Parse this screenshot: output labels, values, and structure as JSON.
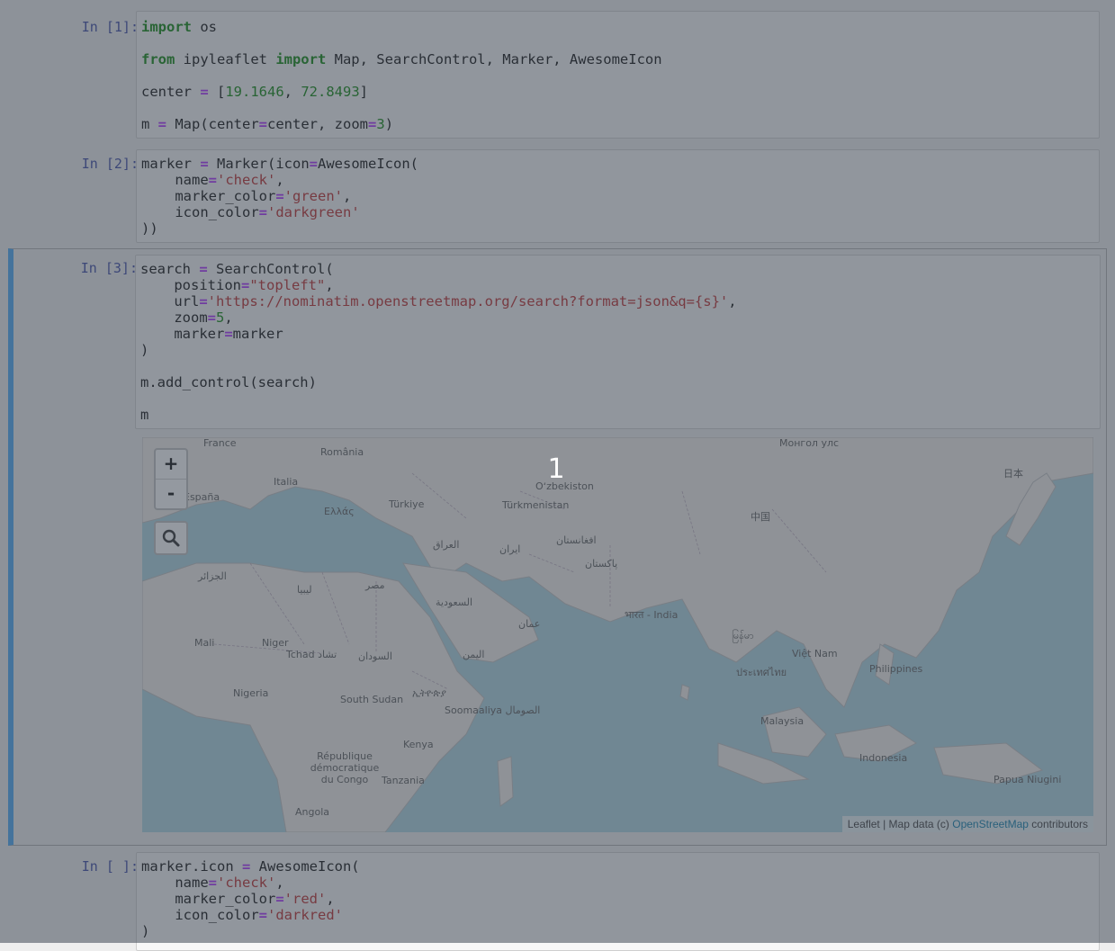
{
  "cells": [
    {
      "prompt": "In [1]:",
      "lines": [
        [
          {
            "t": "import",
            "c": "kw"
          },
          {
            "t": " os"
          }
        ],
        [],
        [
          {
            "t": "from",
            "c": "kw"
          },
          {
            "t": " ipyleaflet "
          },
          {
            "t": "import",
            "c": "kw"
          },
          {
            "t": " Map, SearchControl, Marker, AwesomeIcon"
          }
        ],
        [],
        [
          {
            "t": "center "
          },
          {
            "t": "=",
            "c": "op"
          },
          {
            "t": " ["
          },
          {
            "t": "19.1646",
            "c": "num"
          },
          {
            "t": ", "
          },
          {
            "t": "72.8493",
            "c": "num"
          },
          {
            "t": "]"
          }
        ],
        [],
        [
          {
            "t": "m "
          },
          {
            "t": "=",
            "c": "op"
          },
          {
            "t": " Map(center"
          },
          {
            "t": "=",
            "c": "op"
          },
          {
            "t": "center, zoom"
          },
          {
            "t": "=",
            "c": "op"
          },
          {
            "t": "3",
            "c": "num"
          },
          {
            "t": ")"
          }
        ]
      ]
    },
    {
      "prompt": "In [2]:",
      "lines": [
        [
          {
            "t": "marker "
          },
          {
            "t": "=",
            "c": "op"
          },
          {
            "t": " Marker(icon"
          },
          {
            "t": "=",
            "c": "op"
          },
          {
            "t": "AwesomeIcon("
          }
        ],
        [
          {
            "t": "    name"
          },
          {
            "t": "=",
            "c": "op"
          },
          {
            "t": "'check'",
            "c": "str"
          },
          {
            "t": ","
          }
        ],
        [
          {
            "t": "    marker_color"
          },
          {
            "t": "=",
            "c": "op"
          },
          {
            "t": "'green'",
            "c": "str"
          },
          {
            "t": ","
          }
        ],
        [
          {
            "t": "    icon_color"
          },
          {
            "t": "=",
            "c": "op"
          },
          {
            "t": "'darkgreen'",
            "c": "str"
          }
        ],
        [
          {
            "t": "))"
          }
        ]
      ]
    },
    {
      "prompt": "In [3]:",
      "lines": [
        [
          {
            "t": "search "
          },
          {
            "t": "=",
            "c": "op"
          },
          {
            "t": " SearchControl("
          }
        ],
        [
          {
            "t": "    position"
          },
          {
            "t": "=",
            "c": "op"
          },
          {
            "t": "\"topleft\"",
            "c": "str"
          },
          {
            "t": ","
          }
        ],
        [
          {
            "t": "    url"
          },
          {
            "t": "=",
            "c": "op"
          },
          {
            "t": "'https://nominatim.openstreetmap.org/search?format=json&q={s}'",
            "c": "str"
          },
          {
            "t": ","
          }
        ],
        [
          {
            "t": "    zoom"
          },
          {
            "t": "=",
            "c": "op"
          },
          {
            "t": "5",
            "c": "num"
          },
          {
            "t": ","
          }
        ],
        [
          {
            "t": "    marker"
          },
          {
            "t": "=",
            "c": "op"
          },
          {
            "t": "marker"
          }
        ],
        [
          {
            "t": ")"
          }
        ],
        [],
        [
          {
            "t": "m.add_control(search)"
          }
        ],
        [],
        [
          {
            "t": "m"
          }
        ]
      ]
    },
    {
      "prompt": "In [ ]:",
      "lines": [
        [
          {
            "t": "marker.icon "
          },
          {
            "t": "=",
            "c": "op"
          },
          {
            "t": " AwesomeIcon("
          }
        ],
        [
          {
            "t": "    name"
          },
          {
            "t": "=",
            "c": "op"
          },
          {
            "t": "'check'",
            "c": "str"
          },
          {
            "t": ","
          }
        ],
        [
          {
            "t": "    marker_color"
          },
          {
            "t": "=",
            "c": "op"
          },
          {
            "t": "'red'",
            "c": "str"
          },
          {
            "t": ","
          }
        ],
        [
          {
            "t": "    icon_color"
          },
          {
            "t": "=",
            "c": "op"
          },
          {
            "t": "'darkred'",
            "c": "str"
          }
        ],
        [
          {
            "t": ")"
          }
        ]
      ]
    }
  ],
  "map": {
    "zoom_in_label": "+",
    "zoom_out_label": "-",
    "search_icon": "search-icon",
    "attribution": {
      "prefix": "Leaflet | Map data (c) ",
      "link": "OpenStreetMap",
      "suffix": " contributors"
    },
    "labels": [
      "France",
      "România",
      "Italia",
      "Türkiye",
      "Ελλάς",
      "España",
      "Oʻzbekiston",
      "Türkmenistan",
      "中国",
      "日本",
      "العراق",
      "ایران",
      "افغانستان",
      "پاکستان",
      "الجزائر",
      "ليبيا",
      "مصر",
      "السعودية",
      "عمان",
      "भारत - India",
      "Mali",
      "Niger",
      "Tchad تشاد",
      "السودان",
      "اليمن",
      "Nigeria",
      "South Sudan",
      "ኢትዮጵያ",
      "Soomaaliya الصومال",
      "Việt Nam",
      "Philippines",
      "Malaysia",
      "Indonesia",
      "Papua Niugini",
      "Kenya",
      "République démocratique du Congo",
      "Tanzania",
      "Angola",
      "Монгол улс",
      "မြန်မာ",
      "ประเทศไทย"
    ]
  },
  "overlay": {
    "step_number": "1"
  },
  "colors": {
    "keyword": "#008000",
    "operator": "#aa22ff",
    "number": "#008000",
    "string": "#ba2121",
    "prompt": "#303f9f",
    "selected_bar": "#42a5f5",
    "sea": "#aad3df",
    "land": "#f2efe9",
    "overlay": "rgba(70,80,92,0.58)"
  }
}
